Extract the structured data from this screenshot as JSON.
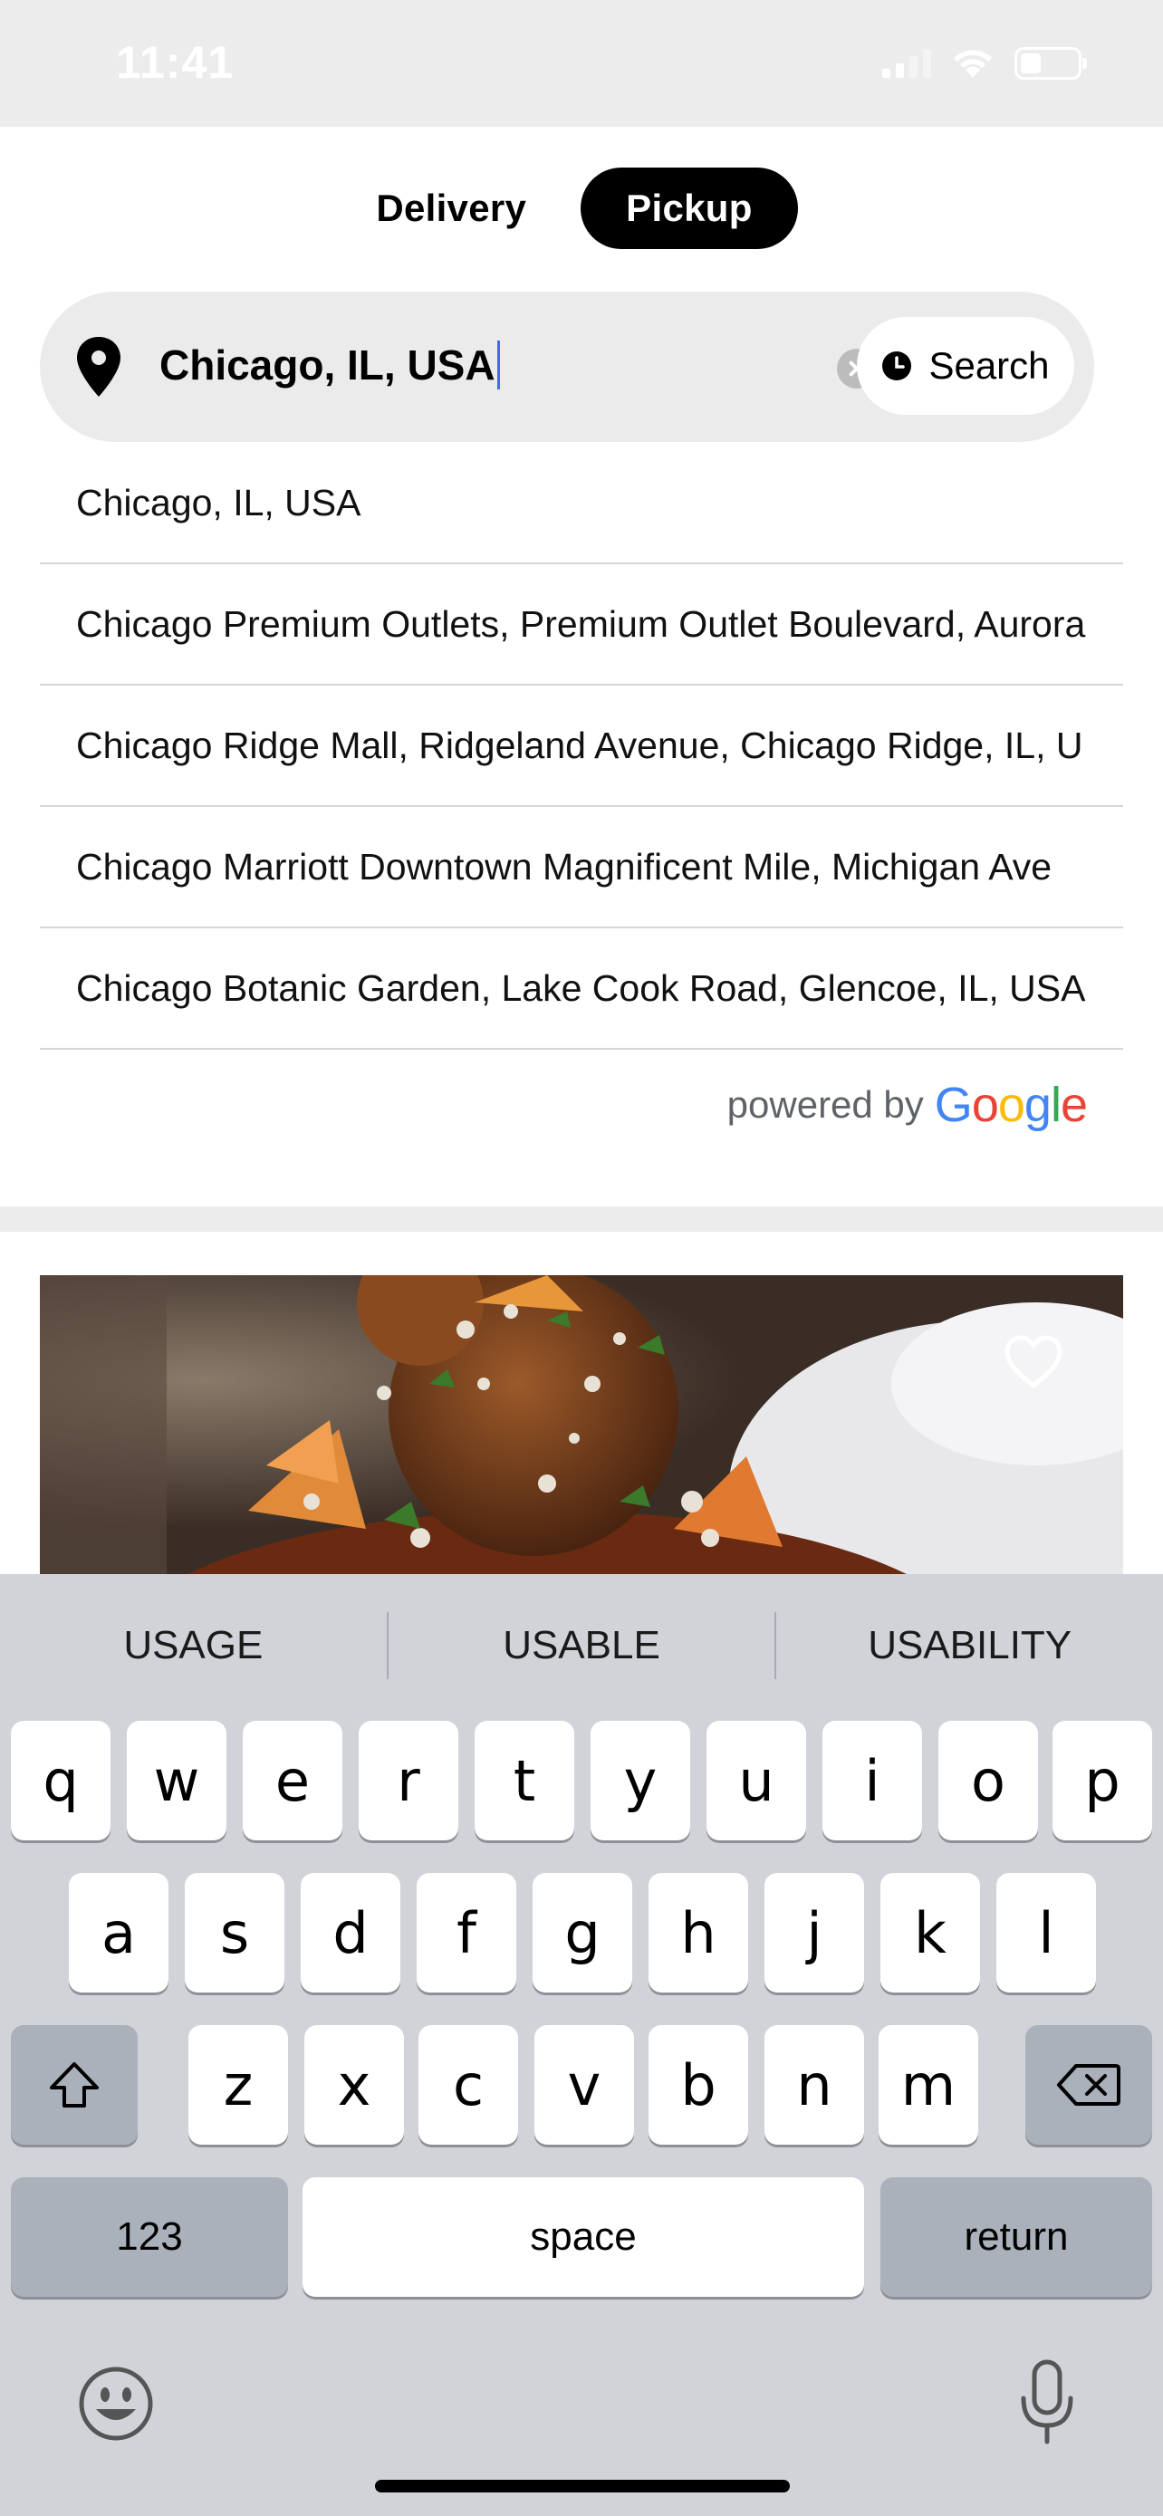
{
  "status_bar": {
    "time": "11:41"
  },
  "mode_toggle": {
    "delivery_label": "Delivery",
    "pickup_label": "Pickup",
    "selected": "Pickup"
  },
  "search": {
    "value": "Chicago, IL, USA",
    "button_label": "Search"
  },
  "suggestions": [
    "Chicago, IL, USA",
    "Chicago Premium Outlets, Premium Outlet Boulevard, Aurora",
    "Chicago Ridge Mall, Ridgeland Avenue, Chicago Ridge, IL, U",
    "Chicago Marriott Downtown Magnificent Mile, Michigan Ave",
    "Chicago Botanic Garden, Lake Cook Road, Glencoe, IL, USA"
  ],
  "attribution": {
    "powered_by": "powered by",
    "brand": "Google",
    "brand_colors": [
      "#4285F4",
      "#EA4335",
      "#FBBC05",
      "#4285F4",
      "#34A853",
      "#EA4335"
    ]
  },
  "keyboard": {
    "predictions": [
      "USAGE",
      "USABLE",
      "USABILITY"
    ],
    "row1": [
      "q",
      "w",
      "e",
      "r",
      "t",
      "y",
      "u",
      "i",
      "o",
      "p"
    ],
    "row2": [
      "a",
      "s",
      "d",
      "f",
      "g",
      "h",
      "j",
      "k",
      "l"
    ],
    "row3": [
      "z",
      "x",
      "c",
      "v",
      "b",
      "n",
      "m"
    ],
    "numbers_label": "123",
    "space_label": "space",
    "return_label": "return"
  },
  "colors": {
    "accent": "#000000",
    "caret": "#3a6ff0",
    "search_bg": "#ebebeb",
    "keyboard_bg": "#d1d3d9"
  }
}
